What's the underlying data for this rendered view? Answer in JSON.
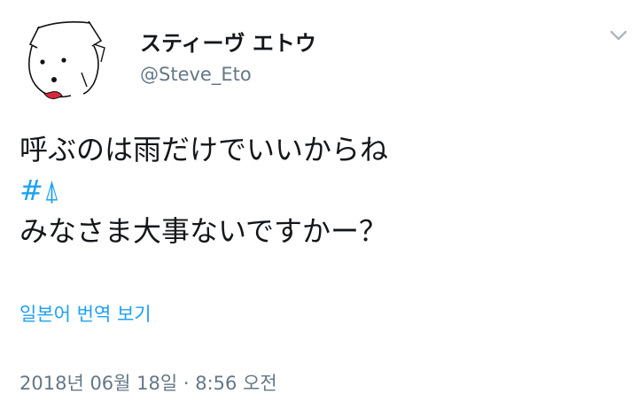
{
  "tweet": {
    "display_name": "スティーヴ エトウ",
    "handle": "@Steve_Eto",
    "avatar_icon": "dog-sketch-avatar-icon",
    "menu_icon": "chevron-down-icon",
    "lines": {
      "line1": "呼ぶのは雨だけでいいからね",
      "hashtag": "#⍋",
      "line3": "みなさま大事ないですかー？"
    },
    "translate_label": "일본어 번역 보기",
    "timestamp": "2018년 06월 18일 · 8:56 오전"
  },
  "colors": {
    "link": "#1da1f2",
    "secondary_text": "#657786",
    "primary_text": "#14171a",
    "background": "#ffffff"
  }
}
